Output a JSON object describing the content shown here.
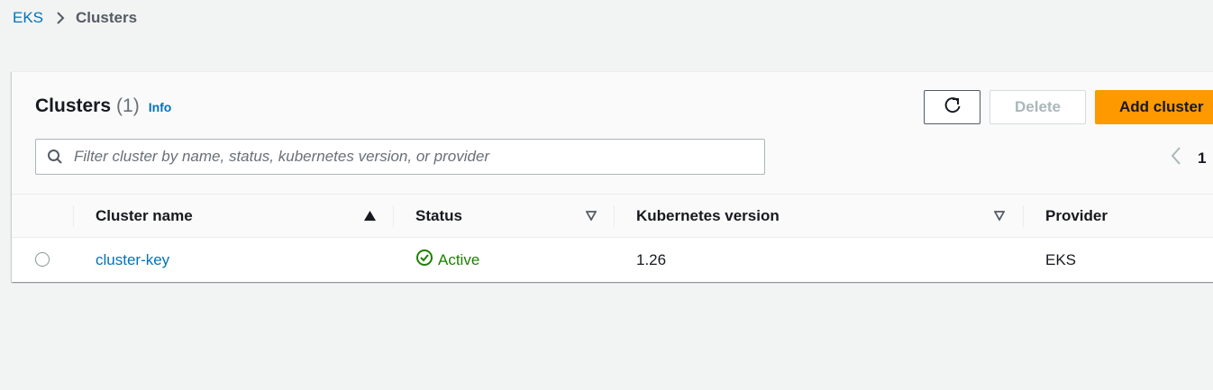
{
  "breadcrumb": {
    "root": "EKS",
    "current": "Clusters"
  },
  "panel": {
    "title": "Clusters",
    "count": "(1)",
    "info": "Info"
  },
  "toolbar": {
    "refresh_icon": "refresh-icon",
    "delete_label": "Delete",
    "add_label": "Add cluster"
  },
  "filter": {
    "placeholder": "Filter cluster by name, status, kubernetes version, or provider",
    "value": ""
  },
  "pagination": {
    "current_page": "1"
  },
  "table": {
    "columns": [
      "Cluster name",
      "Status",
      "Kubernetes version",
      "Provider"
    ],
    "rows": [
      {
        "name": "cluster-key",
        "status": "Active",
        "version": "1.26",
        "provider": "EKS"
      }
    ]
  },
  "colors": {
    "accent_link": "#0073bb",
    "primary_button": "#ff9900",
    "status_active": "#1d8102",
    "background": "#f2f3f3"
  }
}
